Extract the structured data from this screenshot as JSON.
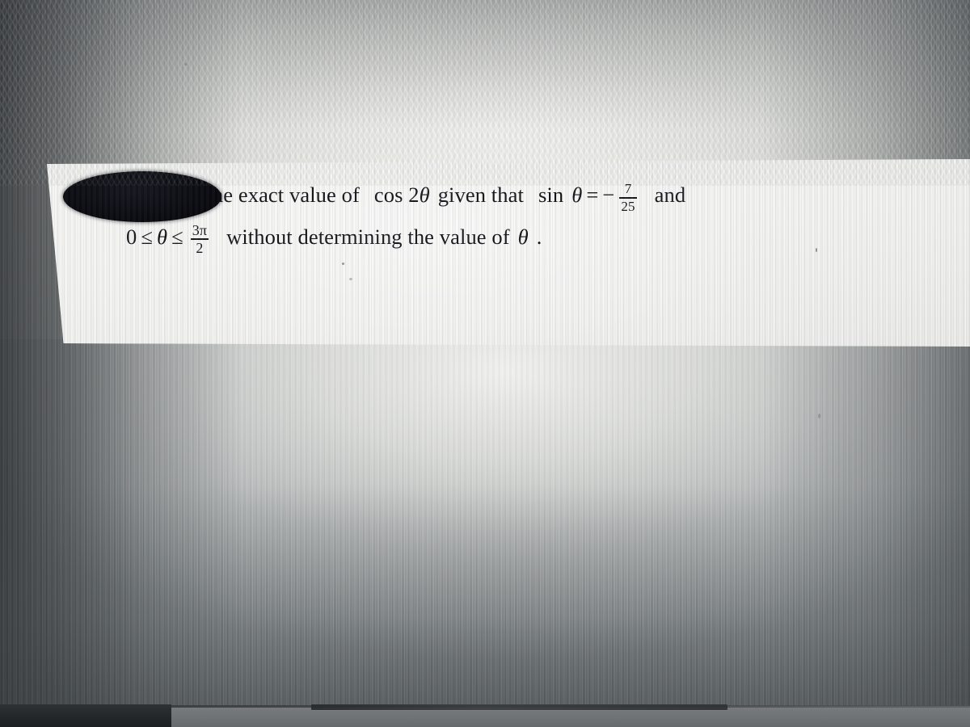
{
  "scene": {
    "kind": "photo-of-screen",
    "subject": "math homework question displayed on a monitor"
  },
  "question": {
    "line1": {
      "lead": "Determine the exact value of",
      "expr_cos": "cos 2",
      "theta_1": "θ",
      "mid": "given that",
      "sin_label": "sin",
      "theta_2": "θ",
      "equals": "=",
      "minus": "−",
      "fraction": {
        "numerator": "7",
        "denominator": "25"
      },
      "trailing": "and"
    },
    "line2": {
      "zero": "0",
      "le_1": "≤",
      "theta": "θ",
      "le_2": "≤",
      "fraction": {
        "numerator": "3π",
        "denominator": "2"
      },
      "rest": "without determining the value of",
      "theta_end": "θ",
      "period": "."
    }
  },
  "redaction": {
    "label": "black-ellipse-redaction",
    "color": "#0a0b10"
  },
  "colors": {
    "paper": "#f4f4f1",
    "ink": "#15161a",
    "screen_background": "#9ea3a5",
    "bezel_dark": "#24272a"
  }
}
